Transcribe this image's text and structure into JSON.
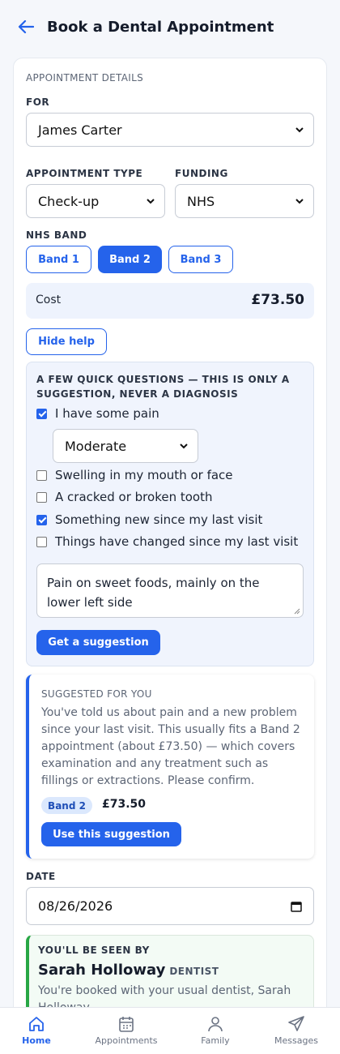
{
  "header": {
    "title": "Book a Dental Appointment",
    "back_icon": "arrow-left-icon"
  },
  "details": {
    "caption": "APPOINTMENT DETAILS",
    "for_label": "FOR",
    "for_value": "James Carter",
    "type_label": "APPOINTMENT TYPE",
    "type_value": "Check-up",
    "funding_label": "FUNDING",
    "funding_value": "NHS",
    "band_label": "NHS BAND",
    "bands": [
      "Band 1",
      "Band 2",
      "Band 3"
    ],
    "selected_band": "Band 2",
    "cost_label": "Cost",
    "cost_value": "£73.50"
  },
  "help": {
    "toggle_label": "Hide help",
    "title": "A FEW QUICK QUESTIONS — THIS IS ONLY A SUGGESTION, NEVER A DIAGNOSIS",
    "pain": {
      "label": "I have some pain",
      "checked": true,
      "severity": "Moderate"
    },
    "swelling": {
      "label": "Swelling in my mouth or face",
      "checked": false
    },
    "cracked": {
      "label": "A cracked or broken tooth",
      "checked": false
    },
    "new_since": {
      "label": "Something new since my last visit",
      "checked": true
    },
    "changed": {
      "label": "Things have changed since my last visit",
      "checked": false
    },
    "notes": "Pain on sweet foods, mainly on the lower left side",
    "submit_label": "Get a suggestion"
  },
  "suggestion": {
    "caption": "SUGGESTED FOR YOU",
    "text": "You've told us about pain and a new problem since your last visit. This usually fits a Band 2 appointment (about £73.50) — which covers examination and any treatment such as fillings or extractions. Please confirm.",
    "band": "Band 2",
    "price": "£73.50",
    "button_label": "Use this suggestion"
  },
  "date": {
    "label": "DATE",
    "value": "08/26/2026"
  },
  "seen_by": {
    "caption": "YOU'LL BE SEEN BY",
    "name": "Sarah Holloway",
    "role": "DENTIST",
    "text": "You're booked with your usual dentist, Sarah Holloway."
  },
  "nav": {
    "active": "Home",
    "items": [
      {
        "label": "Home",
        "icon": "home-icon"
      },
      {
        "label": "Appointments",
        "icon": "calendar-icon"
      },
      {
        "label": "Family",
        "icon": "person-icon"
      },
      {
        "label": "Messages",
        "icon": "send-icon"
      }
    ]
  },
  "colors": {
    "accent": "#2563eb",
    "success": "#28a745",
    "help_bg": "#f0f4fd"
  }
}
